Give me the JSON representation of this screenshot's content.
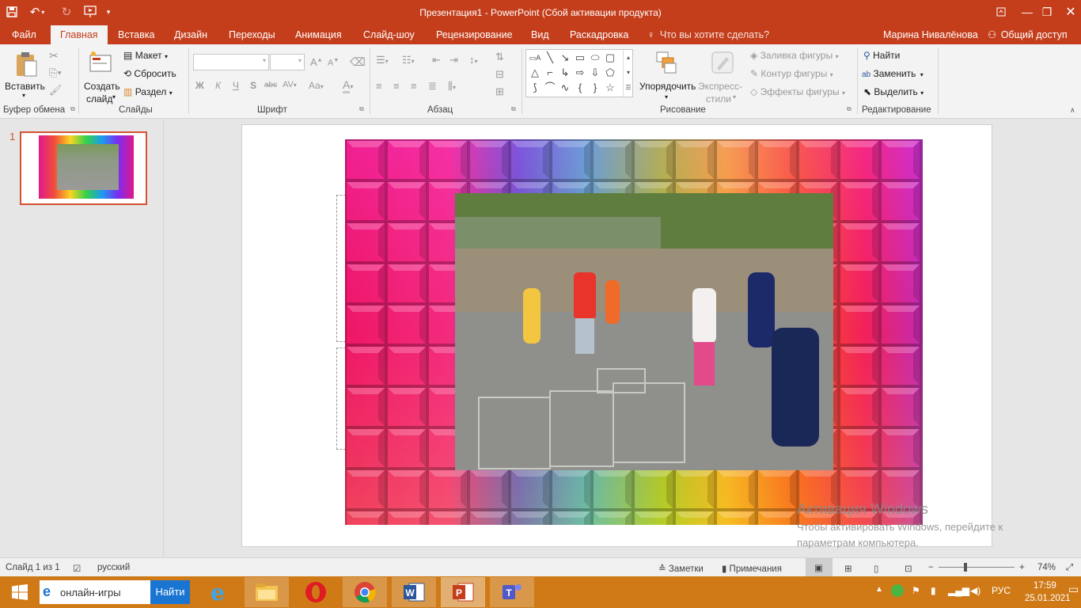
{
  "title_bar": {
    "title": "Презентация1 - PowerPoint (Сбой активации продукта)",
    "quick_access": [
      "save-icon",
      "undo-icon",
      "redo-icon",
      "start-from-beginning-icon",
      "customize-icon"
    ]
  },
  "tabs": {
    "file": "Файл",
    "home": "Главная",
    "insert": "Вставка",
    "design": "Дизайн",
    "transitions": "Переходы",
    "animation": "Анимация",
    "slideshow": "Слайд-шоу",
    "review": "Рецензирование",
    "view": "Вид",
    "storyboard": "Раскадровка",
    "tell_me": "Что вы хотите сделать?",
    "user": "Марина Нивалёнова",
    "share": "Общий доступ"
  },
  "ribbon": {
    "clipboard": {
      "paste": "Вставить",
      "label": "Буфер обмена"
    },
    "slides": {
      "new_slide_1": "Создать",
      "new_slide_2": "слайд",
      "layout": "Макет",
      "reset": "Сбросить",
      "section": "Раздел",
      "label": "Слайды"
    },
    "font": {
      "label": "Шрифт",
      "bold": "Ж",
      "italic": "К",
      "underline": "Ч",
      "shadow": "S",
      "strike": "abc",
      "spacing": "AV",
      "case": "Aa",
      "color": "A",
      "grow": "A",
      "shrink": "A"
    },
    "paragraph": {
      "label": "Абзац"
    },
    "drawing": {
      "arrange": "Упорядочить",
      "quick_styles_1": "Экспресс-",
      "quick_styles_2": "стили",
      "fill": "Заливка фигуры",
      "outline": "Контур фигуры",
      "effects": "Эффекты фигуры",
      "label": "Рисование"
    },
    "editing": {
      "find": "Найти",
      "replace": "Заменить",
      "select": "Выделить",
      "label": "Редактирование"
    }
  },
  "slide_panel": {
    "slide_number": "1"
  },
  "watermark": {
    "title": "Активация Windows",
    "line1": "Чтобы активировать Windows, перейдите к",
    "line2": "параметрам компьютера."
  },
  "status_bar": {
    "slide_info": "Слайд 1 из 1",
    "language": "русский",
    "notes": "Заметки",
    "comments": "Примечания",
    "zoom": "74%",
    "zoom_value": 0.74
  },
  "taskbar": {
    "search_text": "онлайн-игры",
    "search_button": "Найти",
    "apps": [
      "internet-explorer-icon",
      "file-explorer-icon",
      "opera-icon",
      "chrome-icon",
      "word-icon",
      "powerpoint-icon",
      "teams-icon"
    ],
    "language": "РУС",
    "time": "17:59",
    "date": "25.01.2021"
  },
  "colors": {
    "accent": "#c43e1c",
    "thumb_border": "#d35230",
    "taskbar": "#cf7a17"
  }
}
